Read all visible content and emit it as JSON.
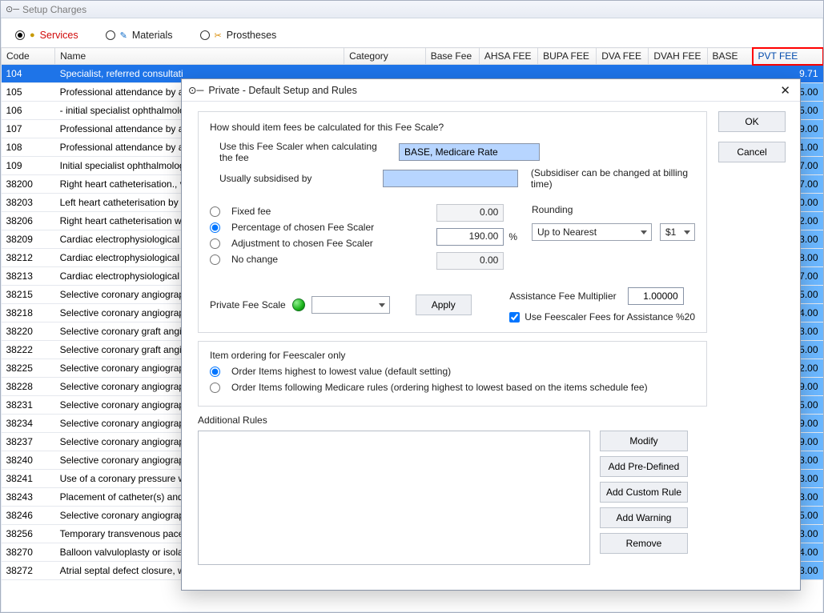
{
  "window": {
    "title": "Setup Charges"
  },
  "tabs": {
    "services": "Services",
    "materials": "Materials",
    "prostheses": "Prostheses"
  },
  "columns": {
    "code": "Code",
    "name": "Name",
    "category": "Category",
    "base": "Base Fee",
    "ahsa": "AHSA FEE",
    "bupa": "BUPA FEE",
    "dva": "DVA FEE",
    "dvah": "DVAH FEE",
    "basecol": "BASE",
    "pvt": "PVT FEE"
  },
  "rows": [
    {
      "code": "104",
      "name": "Specialist, referred consultati",
      "pvt": "9.71",
      "sel": true
    },
    {
      "code": "105",
      "name": "Professional attendance by a",
      "pvt": "5.00"
    },
    {
      "code": "106",
      "name": "- initial specialist ophthalmolog",
      "pvt": "5.00"
    },
    {
      "code": "107",
      "name": "Professional attendance by a",
      "pvt": "9.00"
    },
    {
      "code": "108",
      "name": "Professional attendance by a",
      "pvt": "1.00"
    },
    {
      "code": "109",
      "name": "Initial specialist ophthalmolog",
      "pvt": "7.00"
    },
    {
      "code": "38200",
      "name": "Right heart catheterisation., v",
      "pvt": "7.00"
    },
    {
      "code": "38203",
      "name": "Left heart catheterisation by p",
      "pvt": "0.00"
    },
    {
      "code": "38206",
      "name": "Right heart catheterisation wi",
      "pvt": "2.00"
    },
    {
      "code": "38209",
      "name": "Cardiac electrophysiological s",
      "pvt": "3.00"
    },
    {
      "code": "38212",
      "name": "Cardiac electrophysiological s",
      "pvt": "8.00"
    },
    {
      "code": "38213",
      "name": "Cardiac electrophysiological s",
      "pvt": "7.00"
    },
    {
      "code": "38215",
      "name": "Selective coronary angiograp",
      "pvt": "5.00"
    },
    {
      "code": "38218",
      "name": "Selective coronary angiograp",
      "pvt": "4.00"
    },
    {
      "code": "38220",
      "name": "Selective coronary graft angic",
      "pvt": "3.00"
    },
    {
      "code": "38222",
      "name": "Selective coronary graft angic",
      "pvt": "5.00"
    },
    {
      "code": "38225",
      "name": "Selective coronary angiograp",
      "pvt": "2.00"
    },
    {
      "code": "38228",
      "name": "Selective coronary angiograp",
      "pvt": "9.00"
    },
    {
      "code": "38231",
      "name": "Selective coronary angiograp",
      "pvt": "5.00"
    },
    {
      "code": "38234",
      "name": "Selective coronary angiograp",
      "pvt": "9.00"
    },
    {
      "code": "38237",
      "name": "Selective coronary angiograp",
      "pvt": "9.00"
    },
    {
      "code": "38240",
      "name": "Selective coronary angiograp",
      "pvt": "3.00"
    },
    {
      "code": "38241",
      "name": "Use of a coronary pressure w",
      "pvt": "3.00"
    },
    {
      "code": "38243",
      "name": "Placement of catheter(s) and",
      "pvt": "3.00"
    },
    {
      "code": "38246",
      "name": "Selective coronary angiograp",
      "pvt": "5.00"
    },
    {
      "code": "38256",
      "name": "Temporary transvenous pace",
      "pvt": "3.00"
    },
    {
      "code": "38270",
      "name": "Balloon valvuloplasty or isolat",
      "pvt": "4.00"
    },
    {
      "code": "38272",
      "name": "Atrial septal defect closure, w",
      "pvt": "3.00"
    }
  ],
  "dialog": {
    "title": "Private - Default Setup and Rules",
    "prompt": "How should item fees be calculated for this Fee Scale?",
    "feeScalerLabel": "Use this Fee Scaler when calculating the fee",
    "feeScalerValue": "BASE, Medicare Rate",
    "subsidisedLabel": "Usually subsidised by",
    "subsidisedValue": "",
    "subsidisedNote": "(Subsidiser can be changed at billing time)",
    "fixedFeeLabel": "Fixed fee",
    "fixedFeeValue": "0.00",
    "pctLabel": "Percentage of chosen Fee Scaler",
    "pctValue": "190.00",
    "pctSymbol": "%",
    "adjLabel": "Adjustment to chosen Fee Scaler",
    "adjValue": "0.00",
    "noChangeLabel": "No change",
    "roundingLabel": "Rounding",
    "roundingMode": "Up to Nearest",
    "roundingStep": "$1",
    "assistLabel": "Assistance Fee Multiplier",
    "assistValue": "1.00000",
    "privateScaleLabel": "Private Fee Scale",
    "applyLabel": "Apply",
    "useFeescalerChk": "Use Feescaler Fees for Assistance %20",
    "orderingTitle": "Item ordering for Feescaler only",
    "orderHi": "Order Items highest to lowest value (default setting)",
    "orderMedi": "Order Items following Medicare rules (ordering highest to lowest based on the items schedule fee)",
    "additionalRulesLabel": "Additional Rules",
    "buttons": {
      "ok": "OK",
      "cancel": "Cancel",
      "modify": "Modify",
      "addPre": "Add Pre-Defined",
      "addCustom": "Add Custom Rule",
      "addWarn": "Add Warning",
      "remove": "Remove"
    }
  }
}
